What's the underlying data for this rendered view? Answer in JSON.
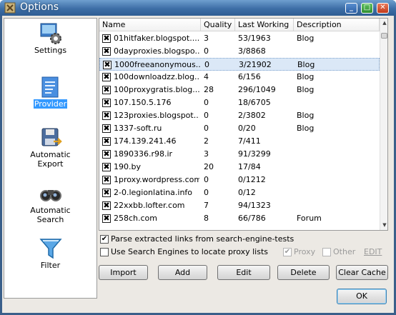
{
  "window": {
    "title": "Options"
  },
  "nav": {
    "items": [
      {
        "key": "settings",
        "label_lines": [
          "Settings"
        ],
        "icon": "settings-icon",
        "selected": false
      },
      {
        "key": "provider",
        "label_lines": [
          "Provider"
        ],
        "icon": "provider-icon",
        "selected": true
      },
      {
        "key": "export",
        "label_lines": [
          "Automatic",
          "Export"
        ],
        "icon": "export-icon",
        "selected": false
      },
      {
        "key": "search",
        "label_lines": [
          "Automatic",
          "Search"
        ],
        "icon": "binoculars-icon",
        "selected": false
      },
      {
        "key": "filter",
        "label_lines": [
          "Filter"
        ],
        "icon": "filter-icon",
        "selected": false
      }
    ]
  },
  "grid": {
    "columns": [
      "Name",
      "Quality",
      "Last Working",
      "Description"
    ],
    "rows": [
      {
        "checked": true,
        "name": "01hitfaker.blogspot....",
        "quality": "3",
        "last": "53/1963",
        "desc": "Blog"
      },
      {
        "checked": true,
        "name": "0dayproxies.blogspo...",
        "quality": "0",
        "last": "3/8868",
        "desc": ""
      },
      {
        "checked": true,
        "name": "1000freeanonymous....",
        "quality": "0",
        "last": "3/21902",
        "desc": "Blog",
        "selected": true
      },
      {
        "checked": true,
        "name": "100downloadzz.blog...",
        "quality": "4",
        "last": "6/156",
        "desc": "Blog"
      },
      {
        "checked": true,
        "name": "100proxygratis.blog...",
        "quality": "28",
        "last": "296/1049",
        "desc": "Blog"
      },
      {
        "checked": true,
        "name": "107.150.5.176",
        "quality": "0",
        "last": "18/6705",
        "desc": ""
      },
      {
        "checked": true,
        "name": "123proxies.blogspot....",
        "quality": "0",
        "last": "2/3802",
        "desc": "Blog"
      },
      {
        "checked": true,
        "name": "1337-soft.ru",
        "quality": "0",
        "last": "0/20",
        "desc": "Blog"
      },
      {
        "checked": true,
        "name": "174.139.241.46",
        "quality": "2",
        "last": "7/411",
        "desc": ""
      },
      {
        "checked": true,
        "name": "1890336.r98.ir",
        "quality": "3",
        "last": "91/3299",
        "desc": ""
      },
      {
        "checked": true,
        "name": "190.by",
        "quality": "20",
        "last": "17/84",
        "desc": ""
      },
      {
        "checked": true,
        "name": "1proxy.wordpress.com",
        "quality": "0",
        "last": "0/1212",
        "desc": ""
      },
      {
        "checked": true,
        "name": "2-0.legionlatina.info",
        "quality": "0",
        "last": "0/12",
        "desc": ""
      },
      {
        "checked": true,
        "name": "22xxbb.lofter.com",
        "quality": "7",
        "last": "94/1323",
        "desc": ""
      },
      {
        "checked": true,
        "name": "258ch.com",
        "quality": "8",
        "last": "66/786",
        "desc": "Forum"
      }
    ]
  },
  "options": {
    "parse_links": {
      "label": "Parse extracted links from search-engine-tests",
      "checked": true
    },
    "use_engines": {
      "label": "Use Search Engines to locate proxy lists",
      "checked": false
    },
    "proxy": {
      "label": "Proxy",
      "checked": true
    },
    "other": {
      "label": "Other",
      "checked": false
    },
    "edit": "EDIT"
  },
  "buttons": {
    "import": "Import",
    "add": "Add",
    "edit": "Edit",
    "delete": "Delete",
    "clear_cache": "Clear Cache",
    "ok": "OK"
  },
  "check_mark": "✖",
  "tick_mark": "✔"
}
